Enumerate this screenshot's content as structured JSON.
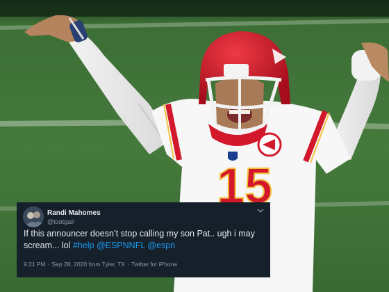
{
  "tweet": {
    "display_name": "Randi Mahomes",
    "handle": "@tootgail",
    "text_before": "If this announcer doesn’t stop calling my son Pat.. ugh i may scream... lol ",
    "hashtag": "#help",
    "mention_1": "@ESPNNFL",
    "mention_2": "@espn",
    "time": "9:21 PM",
    "date": "Sep 28, 2020",
    "location": "from Tyler, TX",
    "separator": "·",
    "client": "Twitter for iPhone"
  },
  "photo": {
    "jersey_number": "15"
  },
  "colors": {
    "card_bg": "#15202b",
    "link": "#1d9bf0",
    "field_green": "#3f7a3a",
    "chiefs_red": "#d3182b"
  },
  "icons": {
    "more": "chevron-down-icon"
  }
}
